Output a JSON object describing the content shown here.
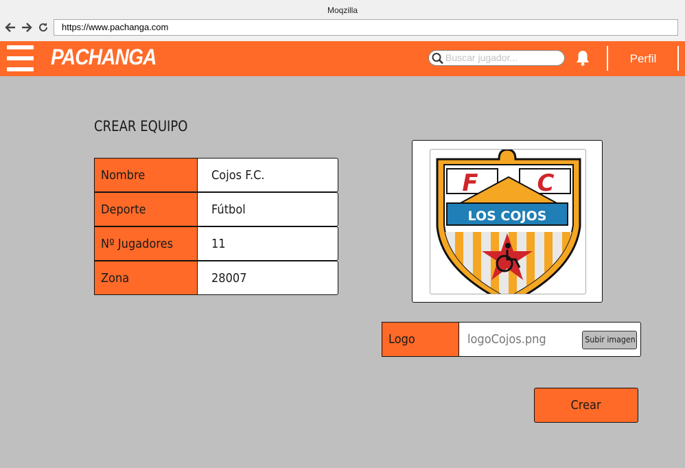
{
  "window": {
    "title": "Moqzilla"
  },
  "browser": {
    "url": "https://www.pachanga.com"
  },
  "header": {
    "logo_text": "PACHANGA",
    "search_placeholder": "Buscar jugador...",
    "profile_label": "Perfil",
    "brand_color": "#ff6a28",
    "icons": [
      "menu-icon",
      "search-icon",
      "bell-icon"
    ]
  },
  "page": {
    "title": "CREAR EQUIPO"
  },
  "form": {
    "fields": [
      {
        "label": "Nombre",
        "value": "Cojos F.C."
      },
      {
        "label": "Deporte",
        "value": "Fútbol"
      },
      {
        "label": "Nº Jugadores",
        "value": "11"
      },
      {
        "label": "Zona",
        "value": "28007"
      }
    ]
  },
  "crest": {
    "letter_left": "F",
    "letter_right": "C",
    "banner_text": "LOS COJOS"
  },
  "logo_field": {
    "label": "Logo",
    "file_name": "logoCojos.png",
    "upload_label": "Subir imagen"
  },
  "actions": {
    "create_label": "Crear"
  }
}
